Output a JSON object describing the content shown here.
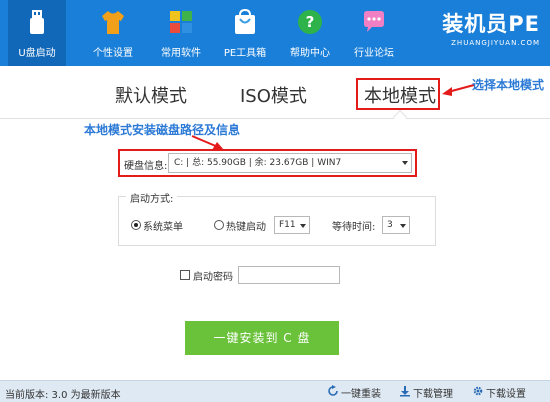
{
  "nav": {
    "items": [
      {
        "label": "U盘启动",
        "icon": "usb-icon"
      },
      {
        "label": "个性设置",
        "icon": "tshirt-icon"
      },
      {
        "label": "常用软件",
        "icon": "apps-grid-icon"
      },
      {
        "label": "PE工具箱",
        "icon": "shopping-bag-icon"
      },
      {
        "label": "帮助中心",
        "icon": "help-icon"
      },
      {
        "label": "行业论坛",
        "icon": "chat-bubble-icon"
      }
    ],
    "active": 0
  },
  "logo": {
    "main": "装机员PE",
    "sub": "ZHUANGJIYUAN.COM"
  },
  "tabs": [
    "默认模式",
    "ISO模式",
    "本地模式"
  ],
  "annotations": {
    "select_local": "选择本地模式",
    "disk_info": "本地模式安装磁盘路径及信息"
  },
  "disk": {
    "label": "硬盘信息:",
    "value": "C: | 总: 55.90GB | 余: 23.67GB | WIN7"
  },
  "boot": {
    "legend": "启动方式:",
    "system_menu": "系统菜单",
    "hotkey": "热键启动",
    "hotkey_value": "F11",
    "wait_label": "等待时间:",
    "wait_value": "3"
  },
  "password": {
    "label": "启动密码"
  },
  "install_button": "一键安装到 C 盘",
  "status": {
    "version": "当前版本: 3.0 为最新版本",
    "reinstall": "一键重装",
    "download_manage": "下载管理",
    "download_settings": "下载设置"
  },
  "colors": {
    "topbar": "#1a7fd8",
    "install": "#6ac23a",
    "annotation": "#2c7ad6",
    "highlight": "#e31b1b"
  }
}
